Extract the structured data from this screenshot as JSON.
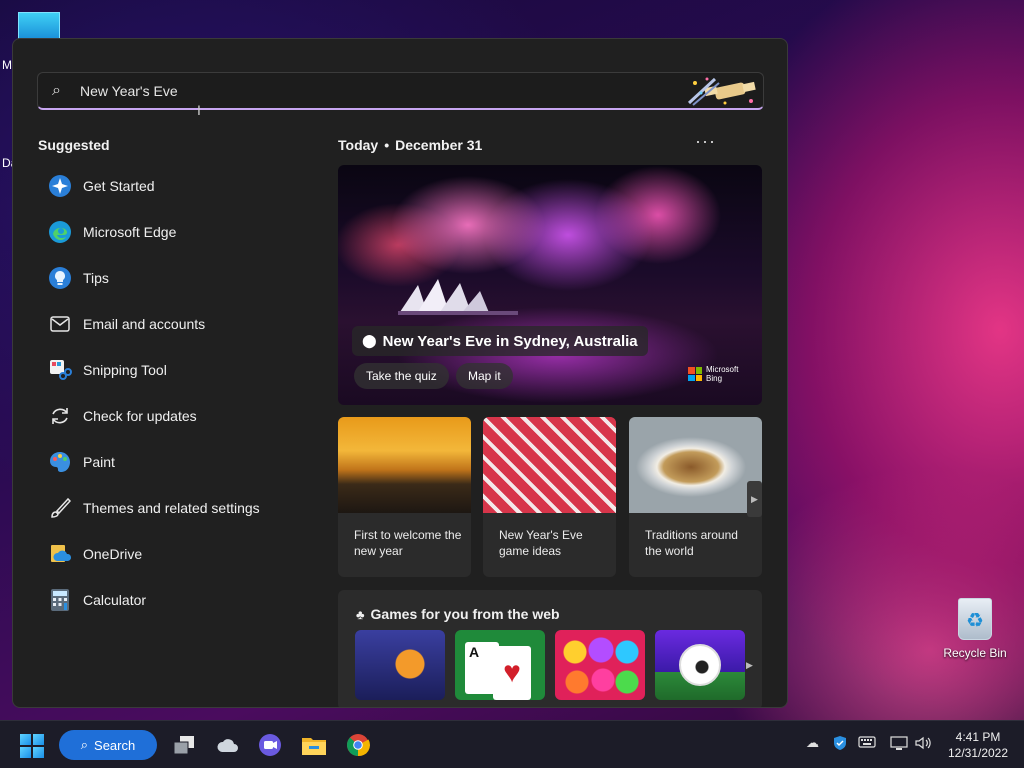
{
  "desktop": {
    "letters": [
      "M",
      "Da"
    ],
    "recycle_bin_label": "Recycle Bin"
  },
  "search": {
    "value": "New Year's Eve",
    "placeholder": "New Year's Eve"
  },
  "suggested": {
    "title": "Suggested",
    "items": [
      {
        "label": "Get Started",
        "icon": "get-started-icon"
      },
      {
        "label": "Microsoft Edge",
        "icon": "edge-icon"
      },
      {
        "label": "Tips",
        "icon": "tips-icon"
      },
      {
        "label": "Email and accounts",
        "icon": "mail-icon"
      },
      {
        "label": "Snipping Tool",
        "icon": "snipping-tool-icon"
      },
      {
        "label": "Check for updates",
        "icon": "refresh-icon"
      },
      {
        "label": "Paint",
        "icon": "paint-icon"
      },
      {
        "label": "Themes and related settings",
        "icon": "brush-icon"
      },
      {
        "label": "OneDrive",
        "icon": "onedrive-icon"
      },
      {
        "label": "Calculator",
        "icon": "calculator-icon"
      }
    ]
  },
  "today": {
    "label": "Today",
    "date": "December 31",
    "more": "···"
  },
  "hero": {
    "location": "New Year's Eve in Sydney, Australia",
    "quiz": "Take the quiz",
    "map": "Map it",
    "brand_line1": "Microsoft",
    "brand_line2": "Bing"
  },
  "cards": [
    {
      "caption": "First to welcome the new year"
    },
    {
      "caption": "New Year's Eve game ideas"
    },
    {
      "caption": "Traditions around the world"
    }
  ],
  "games": {
    "title": "Games for you from the web"
  },
  "taskbar": {
    "search_label": "Search",
    "time": "4:41 PM",
    "date": "12/31/2022"
  },
  "colors": {
    "accent": "#1f6fd8",
    "panel": "#202020",
    "search_underline": "#c7a6f0"
  }
}
